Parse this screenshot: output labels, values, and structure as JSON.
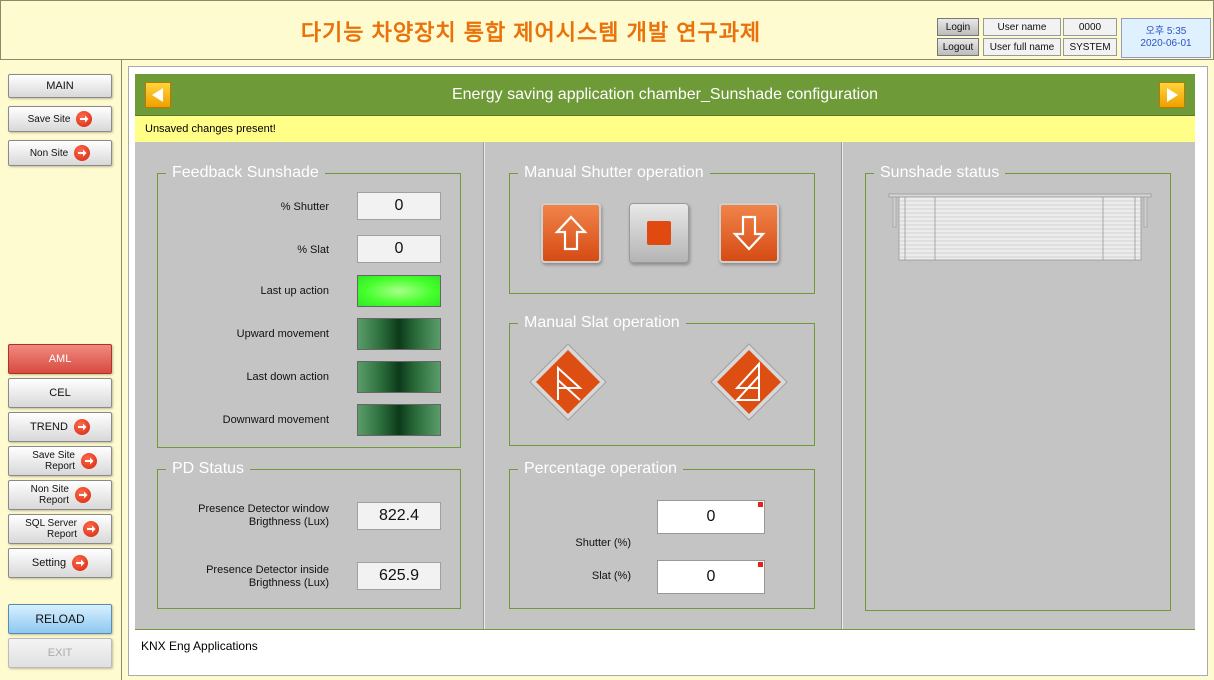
{
  "header": {
    "title": "다기능 차양장치 통합 제어시스템 개발 연구과제",
    "login_label": "Login",
    "logout_label": "Logout",
    "user_name_label": "User name",
    "user_full_name_label": "User full name",
    "user_name_value": "0000",
    "user_full_name_value": "SYSTEM",
    "time": "오후 5:35",
    "date": "2020-06-01"
  },
  "sidebar": {
    "main": "MAIN",
    "save_site": "Save Site",
    "non_site": "Non Site",
    "aml": "AML",
    "cel": "CEL",
    "trend": "TREND",
    "save_site_report": "Save Site Report",
    "non_site_report": "Non Site Report",
    "sql_server_report": "SQL Server Report",
    "setting": "Setting",
    "reload": "RELOAD",
    "exit": "EXIT"
  },
  "page": {
    "title": "Energy saving application chamber_Sunshade configuration",
    "warning": "Unsaved changes present!",
    "footer": "KNX Eng Applications"
  },
  "feedback": {
    "legend": "Feedback Sunshade",
    "shutter_label": "% Shutter",
    "shutter_value": "0",
    "slat_label": "% Slat",
    "slat_value": "0",
    "last_up_label": "Last up action",
    "last_up_on": true,
    "upward_label": "Upward movement",
    "upward_on": false,
    "last_down_label": "Last down action",
    "last_down_on": false,
    "downward_label": "Downward movement",
    "downward_on": false
  },
  "pd_status": {
    "legend": "PD Status",
    "window_label_line1": "Presence Detector window",
    "window_label_line2": "Brigthness (Lux)",
    "window_value": "822.4",
    "inside_label_line1": "Presence Detector inside",
    "inside_label_line2": "Brigthness (Lux)",
    "inside_value": "625.9"
  },
  "manual_shutter": {
    "legend": "Manual Shutter operation"
  },
  "manual_slat": {
    "legend": "Manual Slat operation"
  },
  "percentage": {
    "legend": "Percentage operation",
    "shutter_label": "Shutter (%)",
    "shutter_value": "0",
    "slat_label": "Slat (%)",
    "slat_value": "0"
  },
  "sunshade_status": {
    "legend": "Sunshade status"
  },
  "colors": {
    "title_orange": "#e8730c",
    "panel_green": "#6e9a38",
    "warning_yellow": "#ffff88",
    "content_gray": "#c4c4c4",
    "button_orange": "#d64b14",
    "led_bright_green": "#44ff2a",
    "led_dark_green": "#0c3a1a"
  },
  "icons": {
    "nav_go": "right-arrow-circle-icon",
    "prev_page": "left-triangle-icon",
    "next_page": "right-triangle-icon",
    "shutter_up": "up-arrow-icon",
    "shutter_stop": "stop-square-icon",
    "shutter_down": "down-arrow-icon",
    "slat_open": "slat-tilt-open-icon",
    "slat_close": "slat-tilt-close-icon"
  }
}
